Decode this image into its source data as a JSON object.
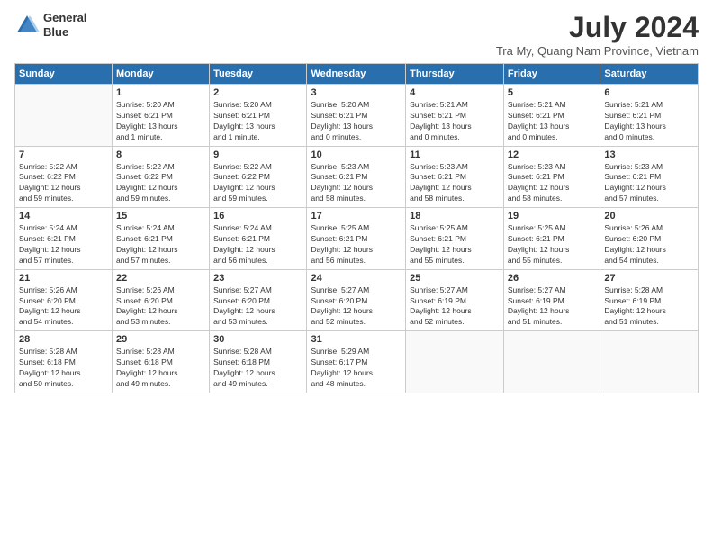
{
  "header": {
    "logo_line1": "General",
    "logo_line2": "Blue",
    "month": "July 2024",
    "location": "Tra My, Quang Nam Province, Vietnam"
  },
  "weekdays": [
    "Sunday",
    "Monday",
    "Tuesday",
    "Wednesday",
    "Thursday",
    "Friday",
    "Saturday"
  ],
  "weeks": [
    [
      {
        "day": "",
        "info": ""
      },
      {
        "day": "1",
        "info": "Sunrise: 5:20 AM\nSunset: 6:21 PM\nDaylight: 13 hours\nand 1 minute."
      },
      {
        "day": "2",
        "info": "Sunrise: 5:20 AM\nSunset: 6:21 PM\nDaylight: 13 hours\nand 1 minute."
      },
      {
        "day": "3",
        "info": "Sunrise: 5:20 AM\nSunset: 6:21 PM\nDaylight: 13 hours\nand 0 minutes."
      },
      {
        "day": "4",
        "info": "Sunrise: 5:21 AM\nSunset: 6:21 PM\nDaylight: 13 hours\nand 0 minutes."
      },
      {
        "day": "5",
        "info": "Sunrise: 5:21 AM\nSunset: 6:21 PM\nDaylight: 13 hours\nand 0 minutes."
      },
      {
        "day": "6",
        "info": "Sunrise: 5:21 AM\nSunset: 6:21 PM\nDaylight: 13 hours\nand 0 minutes."
      }
    ],
    [
      {
        "day": "7",
        "info": "Sunrise: 5:22 AM\nSunset: 6:22 PM\nDaylight: 12 hours\nand 59 minutes."
      },
      {
        "day": "8",
        "info": "Sunrise: 5:22 AM\nSunset: 6:22 PM\nDaylight: 12 hours\nand 59 minutes."
      },
      {
        "day": "9",
        "info": "Sunrise: 5:22 AM\nSunset: 6:22 PM\nDaylight: 12 hours\nand 59 minutes."
      },
      {
        "day": "10",
        "info": "Sunrise: 5:23 AM\nSunset: 6:21 PM\nDaylight: 12 hours\nand 58 minutes."
      },
      {
        "day": "11",
        "info": "Sunrise: 5:23 AM\nSunset: 6:21 PM\nDaylight: 12 hours\nand 58 minutes."
      },
      {
        "day": "12",
        "info": "Sunrise: 5:23 AM\nSunset: 6:21 PM\nDaylight: 12 hours\nand 58 minutes."
      },
      {
        "day": "13",
        "info": "Sunrise: 5:23 AM\nSunset: 6:21 PM\nDaylight: 12 hours\nand 57 minutes."
      }
    ],
    [
      {
        "day": "14",
        "info": "Sunrise: 5:24 AM\nSunset: 6:21 PM\nDaylight: 12 hours\nand 57 minutes."
      },
      {
        "day": "15",
        "info": "Sunrise: 5:24 AM\nSunset: 6:21 PM\nDaylight: 12 hours\nand 57 minutes."
      },
      {
        "day": "16",
        "info": "Sunrise: 5:24 AM\nSunset: 6:21 PM\nDaylight: 12 hours\nand 56 minutes."
      },
      {
        "day": "17",
        "info": "Sunrise: 5:25 AM\nSunset: 6:21 PM\nDaylight: 12 hours\nand 56 minutes."
      },
      {
        "day": "18",
        "info": "Sunrise: 5:25 AM\nSunset: 6:21 PM\nDaylight: 12 hours\nand 55 minutes."
      },
      {
        "day": "19",
        "info": "Sunrise: 5:25 AM\nSunset: 6:21 PM\nDaylight: 12 hours\nand 55 minutes."
      },
      {
        "day": "20",
        "info": "Sunrise: 5:26 AM\nSunset: 6:20 PM\nDaylight: 12 hours\nand 54 minutes."
      }
    ],
    [
      {
        "day": "21",
        "info": "Sunrise: 5:26 AM\nSunset: 6:20 PM\nDaylight: 12 hours\nand 54 minutes."
      },
      {
        "day": "22",
        "info": "Sunrise: 5:26 AM\nSunset: 6:20 PM\nDaylight: 12 hours\nand 53 minutes."
      },
      {
        "day": "23",
        "info": "Sunrise: 5:27 AM\nSunset: 6:20 PM\nDaylight: 12 hours\nand 53 minutes."
      },
      {
        "day": "24",
        "info": "Sunrise: 5:27 AM\nSunset: 6:20 PM\nDaylight: 12 hours\nand 52 minutes."
      },
      {
        "day": "25",
        "info": "Sunrise: 5:27 AM\nSunset: 6:19 PM\nDaylight: 12 hours\nand 52 minutes."
      },
      {
        "day": "26",
        "info": "Sunrise: 5:27 AM\nSunset: 6:19 PM\nDaylight: 12 hours\nand 51 minutes."
      },
      {
        "day": "27",
        "info": "Sunrise: 5:28 AM\nSunset: 6:19 PM\nDaylight: 12 hours\nand 51 minutes."
      }
    ],
    [
      {
        "day": "28",
        "info": "Sunrise: 5:28 AM\nSunset: 6:18 PM\nDaylight: 12 hours\nand 50 minutes."
      },
      {
        "day": "29",
        "info": "Sunrise: 5:28 AM\nSunset: 6:18 PM\nDaylight: 12 hours\nand 49 minutes."
      },
      {
        "day": "30",
        "info": "Sunrise: 5:28 AM\nSunset: 6:18 PM\nDaylight: 12 hours\nand 49 minutes."
      },
      {
        "day": "31",
        "info": "Sunrise: 5:29 AM\nSunset: 6:17 PM\nDaylight: 12 hours\nand 48 minutes."
      },
      {
        "day": "",
        "info": ""
      },
      {
        "day": "",
        "info": ""
      },
      {
        "day": "",
        "info": ""
      }
    ]
  ]
}
